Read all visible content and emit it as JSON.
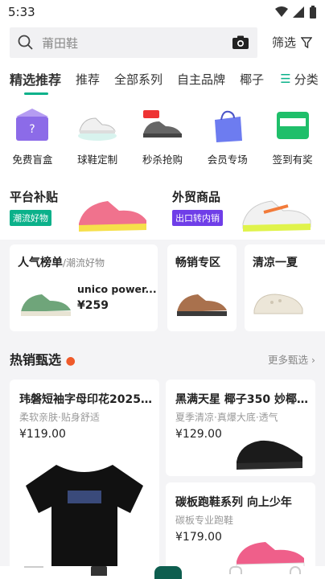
{
  "status": {
    "time": "5:33"
  },
  "search": {
    "placeholder": "莆田鞋"
  },
  "filter": {
    "label": "筛选"
  },
  "tabs": [
    {
      "label": "精选推荐"
    },
    {
      "label": "推荐"
    },
    {
      "label": "全部系列"
    },
    {
      "label": "自主品牌"
    },
    {
      "label": "椰子"
    }
  ],
  "category_button": {
    "label": "分类"
  },
  "quick_links": [
    {
      "label": "免费盲盒",
      "icon": "blind-box-icon"
    },
    {
      "label": "球鞋定制",
      "icon": "sneaker-custom-icon"
    },
    {
      "label": "秒杀抢购",
      "icon": "flash-sale-icon"
    },
    {
      "label": "会员专场",
      "icon": "member-bag-icon"
    },
    {
      "label": "签到有奖",
      "icon": "checkin-icon"
    }
  ],
  "promo": {
    "left": {
      "title": "平台补贴",
      "tag": "潮流好物"
    },
    "right": {
      "title": "外贸商品",
      "tag": "出口转内销"
    }
  },
  "cards": {
    "popular": {
      "title": "人气榜单",
      "subtitle": "/潮流好物",
      "item_name": "unico power...",
      "price": "¥259"
    },
    "bestseller": {
      "title": "畅销专区"
    },
    "cool": {
      "title": "清凉一夏"
    }
  },
  "hot": {
    "title": "热销甄选",
    "more": "更多甄选 ›"
  },
  "products": [
    {
      "title": "玮磐短袖字母印花2025...",
      "subtitle": "柔软亲肤·贴身舒适",
      "price": "¥119.00"
    },
    {
      "title": "黑满天星 椰子350 妙椰...",
      "subtitle": "夏季清凉·真爆大底·透气",
      "price": "¥129.00"
    },
    {
      "title": "碳板跑鞋系列 向上少年",
      "subtitle": "碳板专业跑鞋",
      "price": "¥179.00"
    }
  ],
  "colors": {
    "accent": "#0bb18a",
    "purple": "#6f3ee8"
  }
}
